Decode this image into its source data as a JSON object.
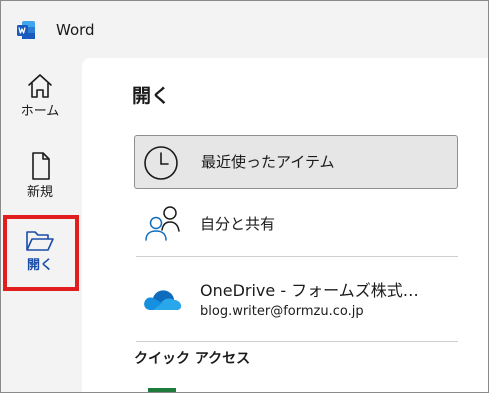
{
  "window": {
    "title": "Word"
  },
  "nav": {
    "items": [
      {
        "label": "ホーム",
        "icon": "home-icon"
      },
      {
        "label": "新規",
        "icon": "new-document-icon"
      },
      {
        "label": "開く",
        "icon": "folder-open-icon",
        "selected": true
      }
    ]
  },
  "main": {
    "title": "開く",
    "locations": [
      {
        "label": "最近使ったアイテム",
        "icon": "clock-icon",
        "selected": true
      },
      {
        "label": "自分と共有",
        "icon": "people-icon"
      },
      {
        "label": "OneDrive - フォームズ株式…",
        "sublabel": "blog.writer@formzu.co.jp",
        "icon": "onedrive-cloud-icon"
      }
    ],
    "section": "クイック アクセス"
  },
  "colors": {
    "accent": "#1a4ea8",
    "highlight": "#e01e1e",
    "word_blue": "#185abd",
    "onedrive_blue": "#0f6cbd"
  }
}
